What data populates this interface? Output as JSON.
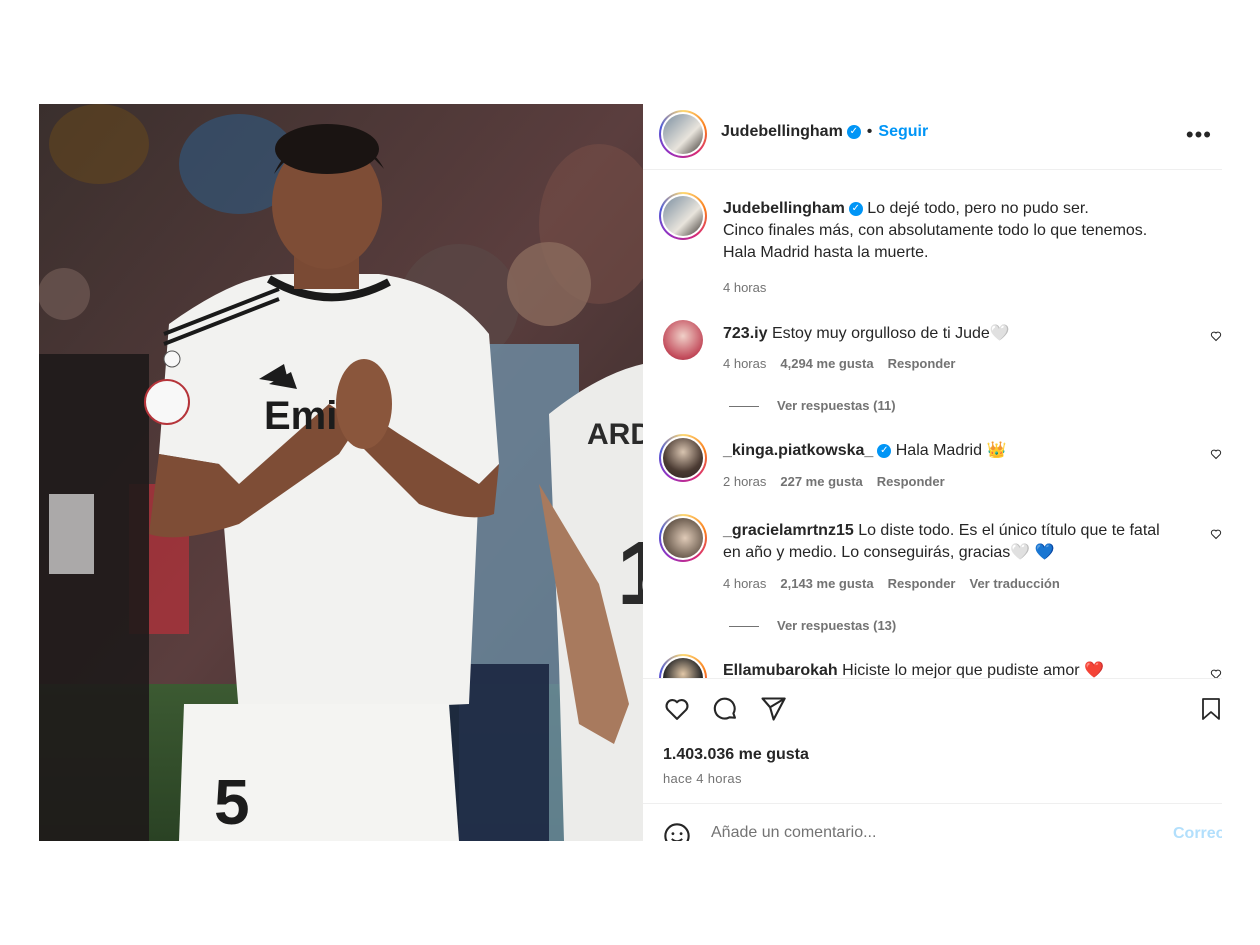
{
  "post": {
    "author": "Judebellingham",
    "follow_label": "Seguir",
    "separator": "•",
    "more_label": "•••",
    "caption_lines": [
      "Lo dejé todo, pero no pudo ser.",
      "Cinco finales más, con absolutamente todo lo que tenemos.",
      "Hala Madrid hasta la muerte."
    ],
    "caption_time": "4 horas",
    "likes": "1.403.036 me gusta",
    "posted": "hace 4 horas",
    "image_jersey_number": "5",
    "image_sponsor": "Emi",
    "image_other_name": "ARD",
    "image_other_number": "1"
  },
  "comments": [
    {
      "user": "723.iy",
      "text": "Estoy muy orgulloso de ti Jude🤍",
      "time": "4 horas",
      "likes": "4,294 me gusta",
      "reply": "Responder",
      "view_replies": "Ver respuestas (11)"
    },
    {
      "user": "_kinga.piatkowska_",
      "verified": true,
      "text": "Hala Madrid 👑",
      "time": "2 horas",
      "likes": "227 me gusta",
      "reply": "Responder"
    },
    {
      "user": "_gracielamrtnz15",
      "text_line1": "Lo diste todo. Es el único título que te fatal",
      "text_line2": "en año y medio. Lo conseguirás, gracias🤍 💙",
      "time": "4 horas",
      "likes": "2,143 me gusta",
      "reply": "Responder",
      "translate": "Ver traducción",
      "view_replies": "Ver respuestas (13)"
    },
    {
      "user": "Ellamubarokah",
      "text": "Hiciste lo mejor que pudiste amor ❤️"
    }
  ],
  "comment_box": {
    "placeholder": "Añade un comentario...",
    "post_label": "Correo"
  },
  "colors": {
    "accent": "#0095f6",
    "text": "#262626",
    "muted": "#737373",
    "border": "#efefef"
  },
  "icons": [
    "heart-icon",
    "comment-icon",
    "share-icon",
    "bookmark-icon",
    "emoji-icon",
    "verified-icon",
    "chevron-right-icon"
  ]
}
